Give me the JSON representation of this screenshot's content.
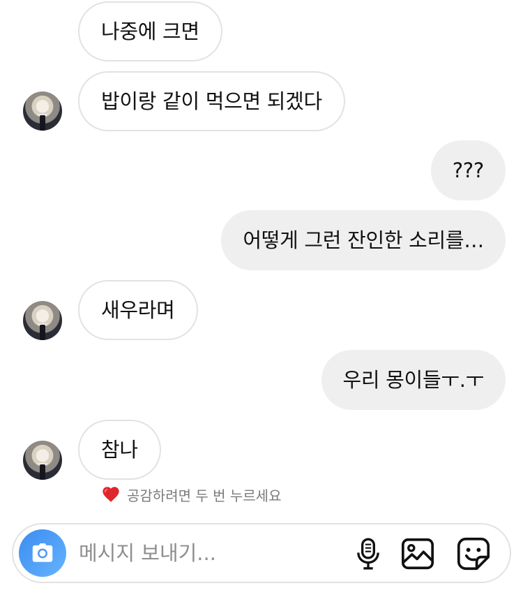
{
  "messages": [
    {
      "side": "received",
      "text": "나중에 크면"
    },
    {
      "side": "received",
      "text": "밥이랑 같이 먹으면 되겠다"
    },
    {
      "side": "sent",
      "text": "???"
    },
    {
      "side": "sent",
      "text": "어떻게 그런 잔인한 소리를…"
    },
    {
      "side": "received",
      "text": "새우라며"
    },
    {
      "side": "sent",
      "text": "우리 몽이들ㅜ.ㅜ"
    },
    {
      "side": "received",
      "text": "참나"
    }
  ],
  "like_hint": {
    "icon": "heart-icon",
    "text": "공감하려면 두 번 누르세요"
  },
  "composer": {
    "placeholder": "메시지 보내기...",
    "icons": [
      "camera-icon",
      "microphone-icon",
      "gallery-icon",
      "sticker-icon"
    ]
  },
  "colors": {
    "sent_bubble": "#efefef",
    "received_border": "#e2e2e2",
    "camera_accent": "#3b8cf0",
    "heart": "#e0262d"
  }
}
